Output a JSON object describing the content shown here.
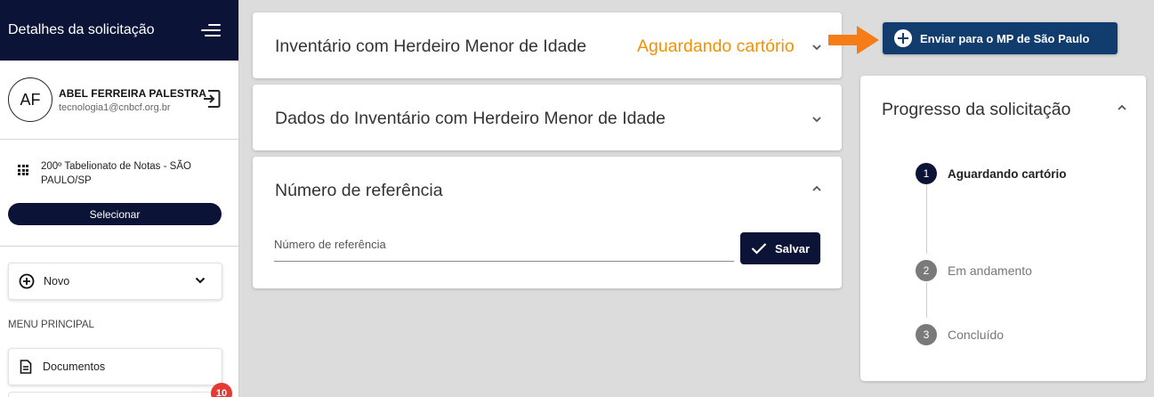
{
  "sidebar": {
    "header_title": "Detalhes da solicitação",
    "user": {
      "initials": "AF",
      "name": "ABEL FERREIRA PALESTRA",
      "email": "tecnologia1@cnbcf.org.br"
    },
    "office": {
      "name": "200º Tabelionato de Notas - SÃO PAULO/SP",
      "select_label": "Selecionar"
    },
    "novo_label": "Novo",
    "menu_title": "MENU PRINCIPAL",
    "documents_label": "Documentos",
    "badge_count": "10"
  },
  "cards": {
    "inventory": {
      "title": "Inventário com Herdeiro Menor de Idade",
      "status": "Aguardando cartório",
      "status_color": "#f29100"
    },
    "inventory_data": {
      "title": "Dados do Inventário com Herdeiro Menor de Idade"
    },
    "reference": {
      "title": "Número de referência",
      "input_placeholder": "Número de referência",
      "input_value": "",
      "save_label": "Salvar"
    }
  },
  "send_button_label": "Enviar para o MP de São Paulo",
  "progress": {
    "title": "Progresso da solicitação",
    "steps": [
      {
        "number": "1",
        "label": "Aguardando cartório",
        "state": "active"
      },
      {
        "number": "2",
        "label": "Em andamento",
        "state": "pending"
      },
      {
        "number": "3",
        "label": "Concluído",
        "state": "pending"
      }
    ]
  },
  "colors": {
    "primary_dark": "#0b1437",
    "send_button": "#103d6e",
    "status_orange": "#f29100",
    "arrow_orange": "#f57c16",
    "badge_red": "#e53935"
  },
  "icons": [
    "menu-icon",
    "logout-icon",
    "grid-icon",
    "plus-circle-icon",
    "chevron-down-icon",
    "document-icon",
    "check-icon",
    "chevron-up-icon",
    "arrow-right-icon"
  ]
}
